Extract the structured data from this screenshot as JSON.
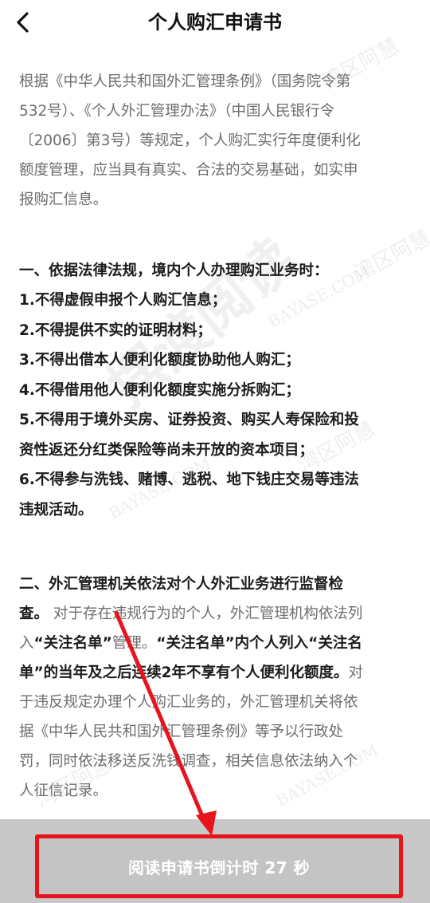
{
  "header": {
    "title": "个人购汇申请书",
    "back_icon": "chevron-left-icon"
  },
  "intro": {
    "lines": [
      "根据《中华人民共和国外汇管理条例》（国务院令第",
      "532号）、《个人外汇管理办法》（中国人民银行令",
      "〔2006〕第3号）等规定，个人购汇实行年度便利化",
      "额度管理，应当具有真实、合法的交易基础，如实申",
      "报购汇信息。"
    ]
  },
  "section1": {
    "title": "一、依据法律法规，境内个人办理购汇业务时：",
    "items": [
      "1.不得虚假申报个人购汇信息；",
      "2.不得提供不实的证明材料；",
      "3.不得出借本人便利化额度协助他人购汇；",
      "4.不得借用他人便利化额度实施分拆购汇；",
      "5.不得用于境外买房、证券投资、购买人寿保险和投",
      "资性返还分红类保险等尚未开放的资本项目；",
      "6.不得参与洗钱、赌博、逃税、地下钱庄交易等违法",
      "违规活动。"
    ]
  },
  "section2": {
    "title_line1": "二、外汇管理机关依法对个人外汇业务进行监督检",
    "title_line2": "查。",
    "line2_rest": "对于存在违规行为的个人，外汇管理机构依法列",
    "line3_a": "入",
    "line3_b": "“关注名单”",
    "line3_c": "管理。",
    "line3_d": "“关注名单”内个人列入“关注名",
    "line4_a": "单”的当年及之后连续2年不享有个人便利化额度。",
    "line4_b": "对",
    "rest_lines": [
      "于违反规定办理个人购汇业务的，外汇管理机关将依",
      "据《中华人民共和国外汇管理条例》等予以行政处",
      "罚，同时依法移送反洗钱调查，相关信息依法纳入个",
      "人征信记录。"
    ]
  },
  "footer": {
    "countdown_label": "阅读申请书倒计时 27 秒"
  },
  "watermarks": {
    "cn": "湾区阿慧",
    "en": "BAYASE.COM",
    "big": "摆渡阅读"
  },
  "colors": {
    "annotation": "#e8141b",
    "button_bg": "#c4c4c4",
    "bar_bg": "#c8c8c8"
  }
}
